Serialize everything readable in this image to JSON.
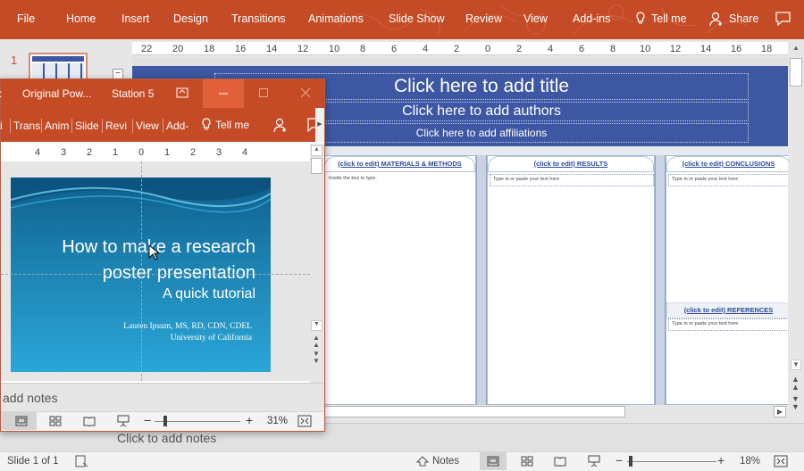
{
  "ribbon": {
    "tabs": [
      "File",
      "Home",
      "Insert",
      "Design",
      "Transitions",
      "Animations",
      "Slide Show",
      "Review",
      "View",
      "Add-ins"
    ],
    "tell_me": "Tell me",
    "share": "Share"
  },
  "ruler": {
    "labels": [
      "22",
      "20",
      "18",
      "16",
      "14",
      "12",
      "10",
      "8",
      "6",
      "4",
      "2",
      "0",
      "2",
      "4",
      "6",
      "8",
      "10",
      "12",
      "14",
      "16",
      "18"
    ]
  },
  "thumbnail": {
    "number": "1"
  },
  "poster": {
    "title": "Click here to add title",
    "authors": "Click here to add authors",
    "affiliations": "Click here to add affiliations",
    "col1_head": "(click to edit)  MATERIALS & METHODS",
    "col1_text": "Inside the box to type.",
    "col2_head": "(click to edit)  RESULTS",
    "col2_text": "Type in or paste your text here",
    "col3_head": "(click to edit)  CONCLUSIONS",
    "col3_text": "Type in or paste your text here",
    "ref_head": "(click to edit)  REFERENCES",
    "ref_text": "Type in or paste your text here"
  },
  "notes": {
    "placeholder": "Click to add notes"
  },
  "status": {
    "slide": "Slide 1 of 1",
    "notes_label": "Notes",
    "zoom": "18%"
  },
  "window2": {
    "title1": "Original Pow...",
    "title2": "Station 5",
    "tabs": [
      "Trans",
      "Anim",
      "Slide",
      "Revi",
      "View",
      "Add-"
    ],
    "tell_me": "Tell me",
    "ruler_labels": [
      "4",
      "3",
      "2",
      "1",
      "0",
      "1",
      "2",
      "3",
      "4"
    ],
    "slide_title": "How to make a research poster presentation",
    "slide_subtitle": "A quick tutorial",
    "author": "Lauren Ipsum, MS, RD, CDN, CDEL",
    "affiliation": "University of California",
    "notes_text": "add notes",
    "zoom": "31%"
  }
}
